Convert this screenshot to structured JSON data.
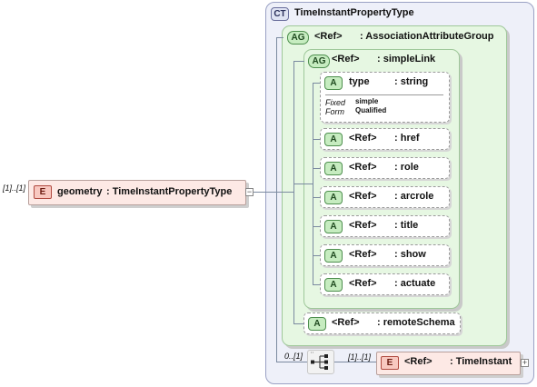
{
  "complex_type": {
    "badge": "CT",
    "name": "TimeInstantPropertyType"
  },
  "root_element": {
    "cardinality": "[1]..[1]",
    "badge": "E",
    "name": "geometry",
    "type": ": TimeInstantPropertyType",
    "expander": "−"
  },
  "association_group": {
    "badge": "AG",
    "ref": "<Ref>",
    "name": ": AssociationAttributeGroup"
  },
  "simple_link": {
    "badge": "AG",
    "ref": "<Ref>",
    "name": ": simpleLink",
    "type_attr": {
      "badge": "A",
      "name": "type",
      "type": ": string",
      "fixed_label": "Fixed",
      "fixed_value": "simple",
      "form_label": "Form",
      "form_value": "Qualified"
    },
    "attributes": [
      {
        "badge": "A",
        "ref": "<Ref>",
        "name": ": href"
      },
      {
        "badge": "A",
        "ref": "<Ref>",
        "name": ": role"
      },
      {
        "badge": "A",
        "ref": "<Ref>",
        "name": ": arcrole"
      },
      {
        "badge": "A",
        "ref": "<Ref>",
        "name": ": title"
      },
      {
        "badge": "A",
        "ref": "<Ref>",
        "name": ": show"
      },
      {
        "badge": "A",
        "ref": "<Ref>",
        "name": ": actuate"
      }
    ]
  },
  "remote_schema": {
    "badge": "A",
    "ref": "<Ref>",
    "name": ": remoteSchema"
  },
  "sequence": {
    "cardinality": "0..[1]"
  },
  "time_instant": {
    "cardinality": "[1]..[1]",
    "badge": "E",
    "ref": "<Ref>",
    "name": ": TimeInstant",
    "expander": "+"
  },
  "colors": {
    "ct_bg": "#eef0f9",
    "ag_bg": "#e6f7e2",
    "element_bg": "#fde9e5",
    "connector": "#7b8aa0"
  }
}
